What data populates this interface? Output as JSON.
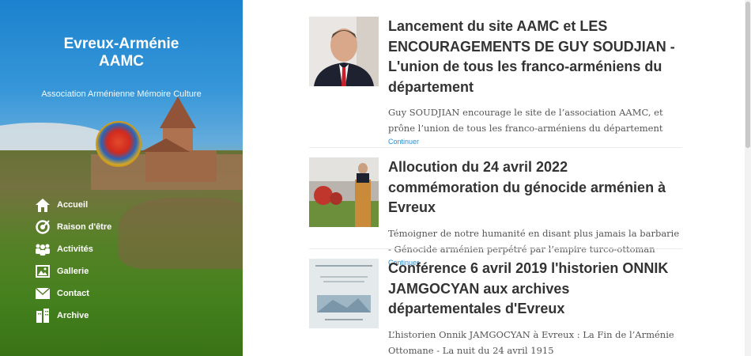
{
  "site": {
    "title": "Evreux-Arménie AAMC",
    "tagline": "Association Arménienne Mémoire Culture"
  },
  "nav": [
    {
      "label": "Accueil",
      "icon": "home-icon"
    },
    {
      "label": "Raison d'être",
      "icon": "target-icon"
    },
    {
      "label": "Activités",
      "icon": "people-icon"
    },
    {
      "label": "Gallerie",
      "icon": "image-icon"
    },
    {
      "label": "Contact",
      "icon": "envelope-icon"
    },
    {
      "label": "Archive",
      "icon": "building-icon"
    }
  ],
  "posts": [
    {
      "title": "Lancement du site AAMC et LES ENCOURAGEMENTS DE GUY SOUDJIAN - L'union de tous les franco-arméniens du département",
      "excerpt": "Guy SOUDJIAN encourage le site de l’association AAMC, et prône l’union de tous les franco-arméniens du département",
      "more": "Continuer"
    },
    {
      "title": "Allocution du 24 avril 2022 commémoration du génocide arménien à Evreux",
      "excerpt": "Témoigner de notre humanité en disant plus jamais la barbarie - Génocide arménien perpétré par l’empire turco-ottoman",
      "more": "Continuer"
    },
    {
      "title": "Conférence 6 avril 2019 l'historien ONNIK JAMGOCYAN aux archives départementales d'Evreux",
      "excerpt": "L’historien Onnik JAMGOCYAN à Evreux : La Fin de l’Arménie Ottomane - La nuit du 24 avril 1915",
      "more": ""
    }
  ],
  "colors": {
    "link": "#2a8fd4",
    "title": "#333333",
    "excerpt": "#555555"
  }
}
